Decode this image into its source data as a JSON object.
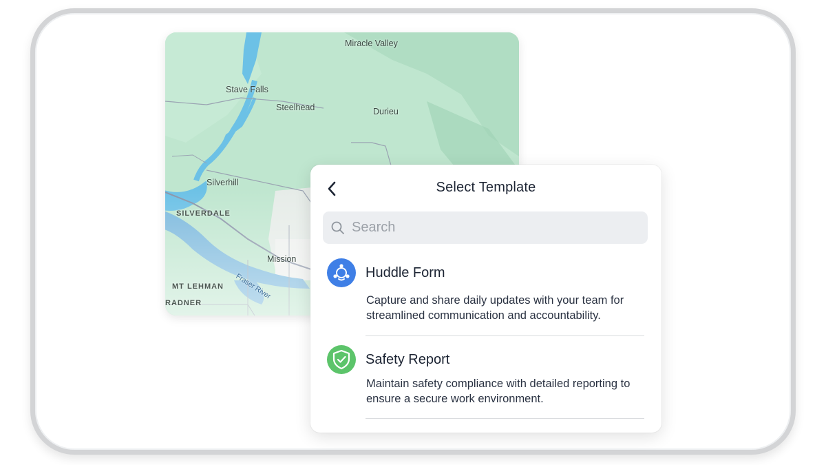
{
  "map": {
    "labels": [
      {
        "text": "Miracle Valley"
      },
      {
        "text": "Stave Falls"
      },
      {
        "text": "Steelhead"
      },
      {
        "text": "Durieu"
      },
      {
        "text": "Silverhill"
      },
      {
        "text": "SILVERDALE"
      },
      {
        "text": "Mission"
      },
      {
        "text": "MT LEHMAN"
      },
      {
        "text": "Fraser River"
      },
      {
        "text": "RADNER"
      }
    ]
  },
  "panel": {
    "title": "Select Template",
    "search_placeholder": "Search",
    "templates": [
      {
        "name": "Huddle Form",
        "description": "Capture and share daily updates with your team for streamlined communication and accountability.",
        "icon": "huddle-people-icon",
        "icon_color": "#3f7fe6"
      },
      {
        "name": "Safety Report",
        "description": "Maintain safety compliance with detailed reporting to ensure a secure work environment.",
        "icon": "shield-check-icon",
        "icon_color": "#5cc46a"
      }
    ]
  }
}
